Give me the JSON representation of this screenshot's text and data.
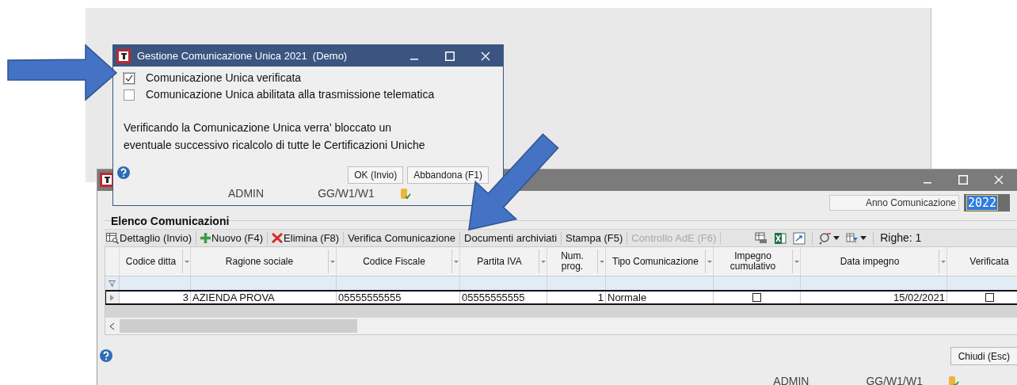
{
  "dialog": {
    "title": "Gestione Comunicazione Unica 2021  (Demo)",
    "checkboxes": [
      {
        "label": "Comunicazione Unica verificata",
        "checked": true
      },
      {
        "label": "Comunicazione Unica abilitata alla trasmissione telematica",
        "checked": false
      }
    ],
    "message": [
      "Verificando la Comunicazione Unica verra' bloccato un",
      "eventuale successivo ricalcolo di tutte le Certificazioni Uniche"
    ],
    "buttons": [
      "OK (Invio)",
      "Abbandona (F1)"
    ],
    "status": {
      "user": "ADMIN",
      "path": "GG/W1/W1"
    }
  },
  "main_window": {
    "anno": {
      "label": "Anno Comunicazione",
      "value": "2022"
    },
    "group_title": "Elenco Comunicazioni",
    "toolbar": [
      {
        "kind": "view",
        "label": "Dettaglio (Invio)",
        "disabled": false
      },
      {
        "kind": "add",
        "label": "Nuovo (F4)",
        "disabled": false
      },
      {
        "kind": "remove",
        "label": "Elimina (F8)",
        "disabled": false
      },
      {
        "kind": "text",
        "label": "Verifica Comunicazione",
        "disabled": false
      },
      {
        "kind": "text",
        "label": "Documenti archiviati",
        "disabled": false
      },
      {
        "kind": "text",
        "label": "Stampa (F5)",
        "disabled": false
      },
      {
        "kind": "text",
        "label": "Controllo AdE (F6)",
        "disabled": true
      }
    ],
    "row_count": "Righe: 1",
    "table": {
      "columns": [
        {
          "label": "Codice ditta",
          "kind": "number"
        },
        {
          "label": "Ragione sociale",
          "kind": "text"
        },
        {
          "label": "Codice Fiscale",
          "kind": "text"
        },
        {
          "label": "Partita IVA",
          "kind": "text"
        },
        {
          "label": "Num.\nprog.",
          "kind": "number"
        },
        {
          "label": "Tipo Comunicazione",
          "kind": "text"
        },
        {
          "label": "Impegno\ncumulativo",
          "kind": "check"
        },
        {
          "label": "Data impegno",
          "kind": "number"
        },
        {
          "label": "Verificata",
          "kind": "check"
        }
      ],
      "rows": [
        {
          "selected": true,
          "cells": [
            {
              "text": "3"
            },
            {
              "text": "AZIENDA PROVA"
            },
            {
              "text": "05555555555"
            },
            {
              "text": "05555555555"
            },
            {
              "text": "1"
            },
            {
              "text": "Normale"
            },
            {
              "checked": false
            },
            {
              "text": "15/02/2021"
            },
            {
              "checked": false
            }
          ]
        }
      ]
    },
    "close_button": "Chiudi (Esc)",
    "status": {
      "user": "ADMIN",
      "path": "GG/W1/W1"
    }
  }
}
